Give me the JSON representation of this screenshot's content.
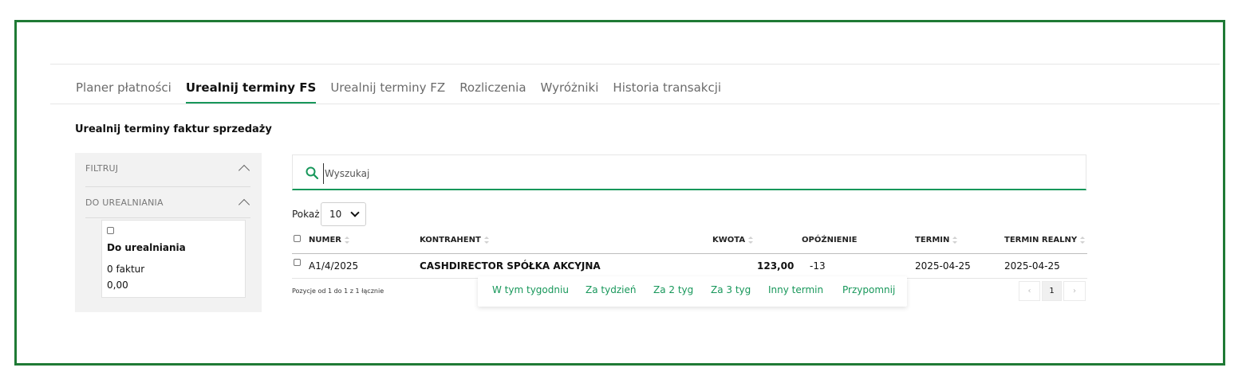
{
  "tabs": [
    {
      "label": "Planer płatności",
      "active": false
    },
    {
      "label": "Urealnij terminy FS",
      "active": true
    },
    {
      "label": "Urealnij terminy FZ",
      "active": false
    },
    {
      "label": "Rozliczenia",
      "active": false
    },
    {
      "label": "Wyróżniki",
      "active": false
    },
    {
      "label": "Historia transakcji",
      "active": false
    }
  ],
  "page_title": "Urealnij terminy faktur sprzedaży",
  "filters": {
    "section1_label": "FILTRUJ",
    "section2_label": "DO UREALNIANIA",
    "card": {
      "label": "Do urealniania",
      "count": "0 faktur",
      "amount": "0,00",
      "checked": false
    }
  },
  "search": {
    "placeholder": "Wyszukaj",
    "value": ""
  },
  "page_size": {
    "label": "Pokaż",
    "value": "10"
  },
  "table": {
    "columns": [
      "NUMER",
      "KONTRAHENT",
      "KWOTA",
      "OPÓŹNIENIE",
      "TERMIN",
      "TERMIN REALNY"
    ],
    "rows": [
      {
        "numer": "A1/4/2025",
        "kontrahent": "CASHDIRECTOR SPÓŁKA AKCYJNA",
        "kwota": "123,00",
        "opoznienie": "-13",
        "termin": "2025-04-25",
        "termin_realny": "2025-04-25"
      }
    ],
    "summary": "Pozycje od 1 do 1 z 1 łącznie"
  },
  "popover": {
    "items": [
      "W tym tygodniu",
      "Za tydzień",
      "Za 2 tyg",
      "Za 3 tyg",
      "Inny termin",
      "Przypomnij"
    ]
  },
  "pagination": {
    "prev": "‹",
    "current": "1",
    "next": "›"
  },
  "colors": {
    "accent": "#17975a",
    "frame": "#1f7a35"
  }
}
